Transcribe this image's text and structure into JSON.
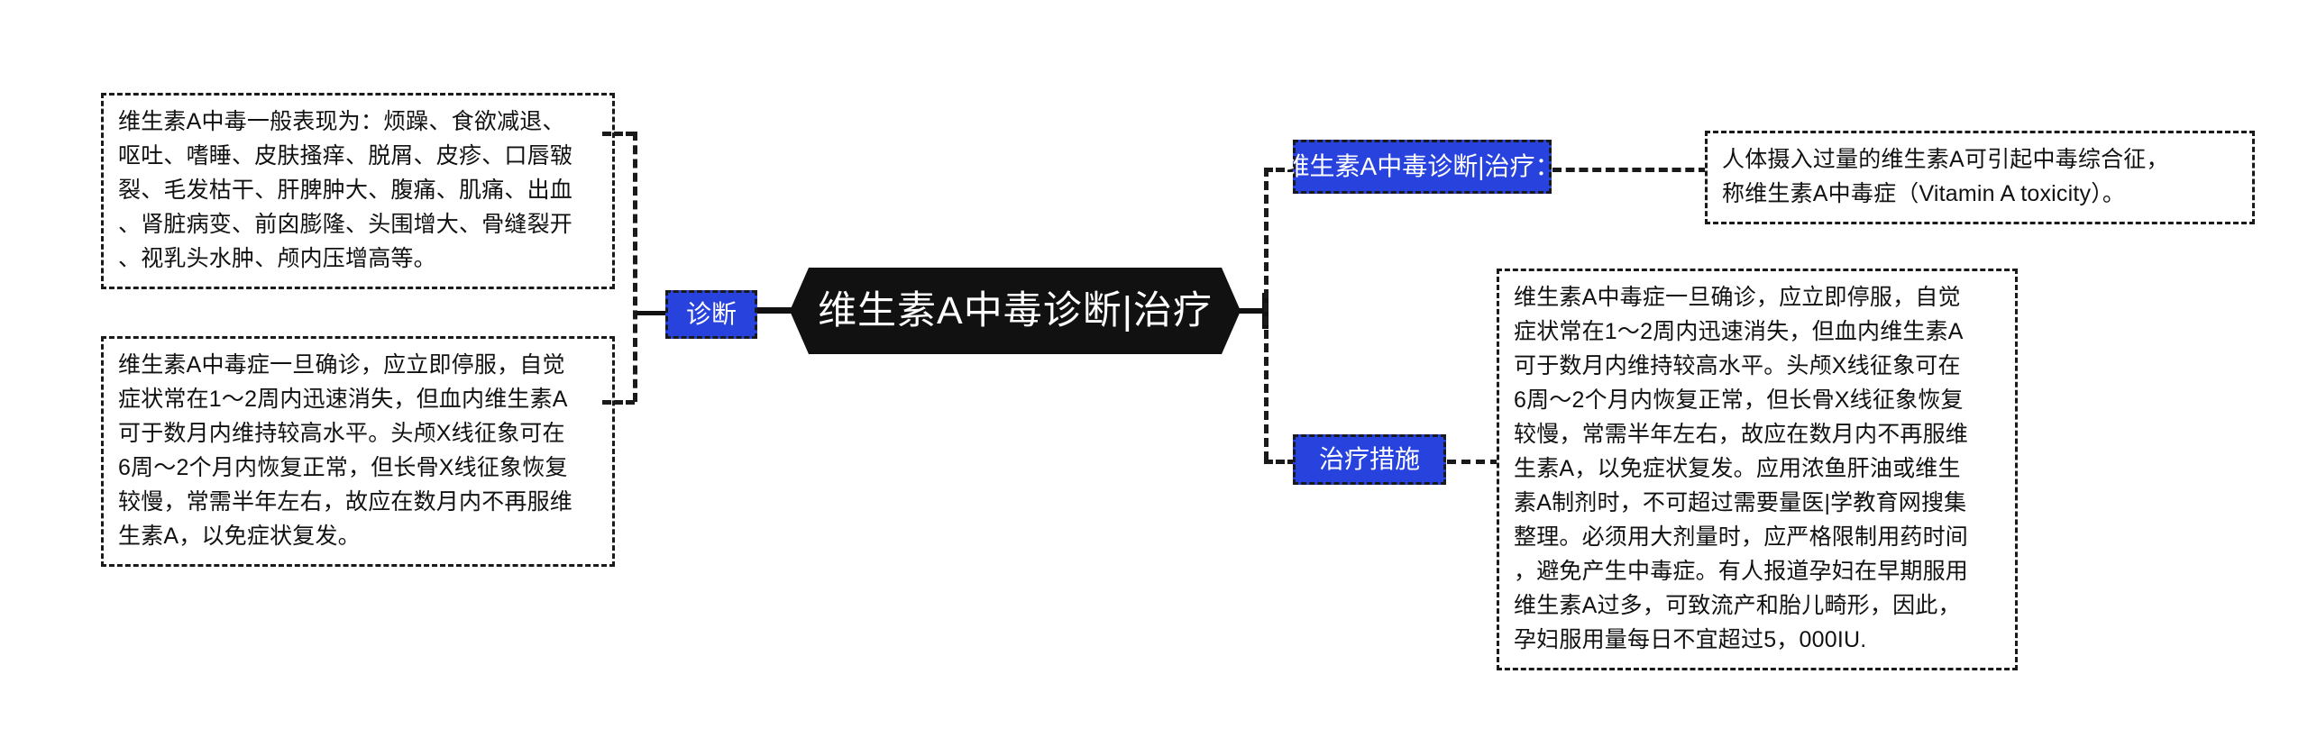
{
  "diagram": {
    "type": "mind-map",
    "colors": {
      "central_node_bg": "#111111",
      "central_node_text": "#ffffff",
      "branch_node_bg": "#2742dd",
      "branch_node_text": "#ffffff",
      "note_border": "#1a1a1a",
      "note_text": "#111111",
      "background": "#ffffff"
    },
    "central_node": {
      "label": "维生素A中毒诊断|治疗"
    },
    "branches": [
      {
        "id": "diagnosis",
        "label": "诊断",
        "side": "left",
        "notes": [
          "维生素A中毒一般表现为：烦躁、食欲减退、\n呕吐、嗜睡、皮肤搔痒、脱屑、皮疹、口唇皲\n裂、毛发枯干、肝脾肿大、腹痛、肌痛、出血\n、肾脏病变、前囟膨隆、头围增大、骨缝裂开\n、视乳头水肿、颅内压增高等。",
          "维生素A中毒症一旦确诊，应立即停服，自觉\n症状常在1～2周内迅速消失，但血内维生素A\n可于数月内维持较高水平。头颅X线征象可在\n6周～2个月内恢复正常，但长骨X线征象恢复\n较慢，常需半年左右，故应在数月内不再服维\n生素A，以免症状复发。"
        ]
      },
      {
        "id": "title-right",
        "label": "维生素A中毒诊断|治疗：",
        "side": "right",
        "notes": [
          "人体摄入过量的维生素A可引起中毒综合征，\n称维生素A中毒症（Vitamin A toxicity）。"
        ]
      },
      {
        "id": "measures",
        "label": "治疗措施",
        "side": "right",
        "notes": [
          "维生素A中毒症一旦确诊，应立即停服，自觉\n症状常在1～2周内迅速消失，但血内维生素A\n可于数月内维持较高水平。头颅X线征象可在\n6周～2个月内恢复正常，但长骨X线征象恢复\n较慢，常需半年左右，故应在数月内不再服维\n生素A，以免症状复发。应用浓鱼肝油或维生\n素A制剂时，不可超过需要量医|学教育网搜集\n整理。必须用大剂量时，应严格限制用药时间\n，避免产生中毒症。有人报道孕妇在早期服用\n维生素A过多，可致流产和胎儿畸形，因此，\n孕妇服用量每日不宜超过5，000IU."
        ]
      }
    ]
  }
}
